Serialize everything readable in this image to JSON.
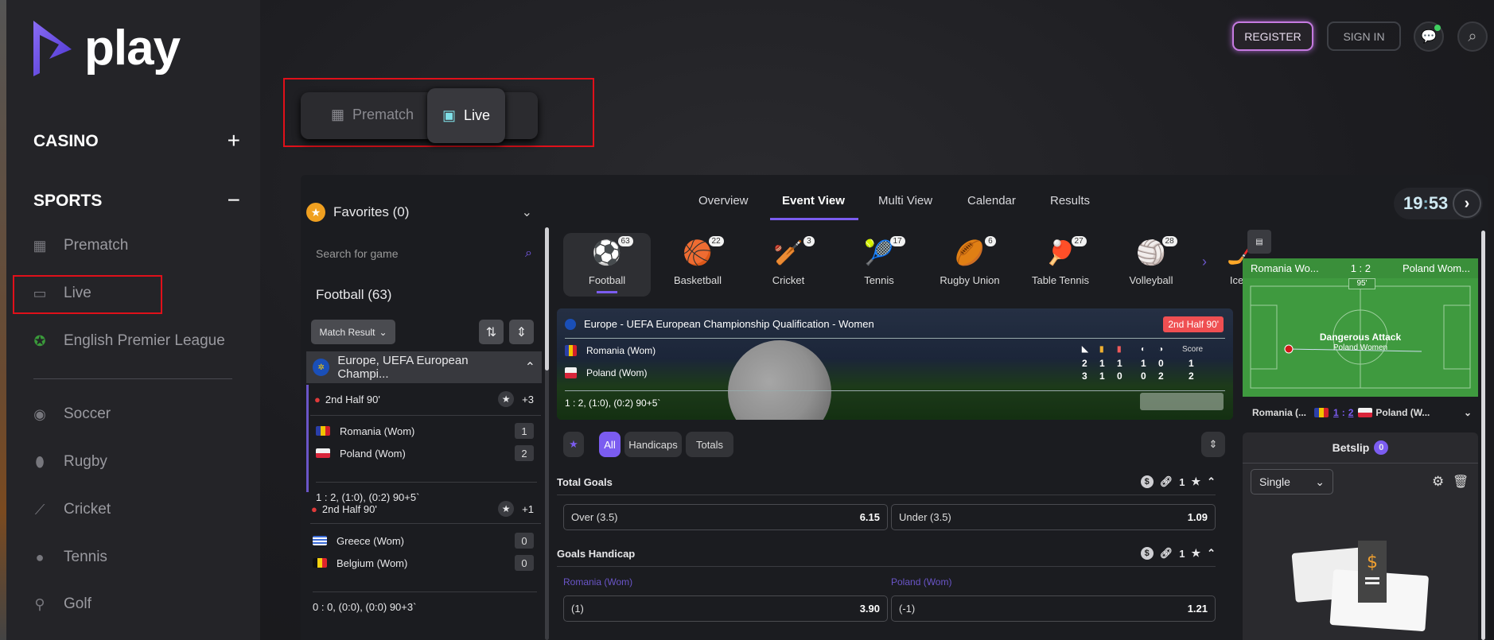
{
  "brand": {
    "name": "play",
    "accent": "#7b5cf0"
  },
  "sidebar": {
    "casino": {
      "label": "CASINO",
      "toggle": "+"
    },
    "sports": {
      "label": "SPORTS",
      "toggle": "−"
    },
    "items": [
      {
        "label": "Prematch",
        "icon": "calendar-icon"
      },
      {
        "label": "Live",
        "icon": "live-tv-icon"
      },
      {
        "label": "English Premier League",
        "icon": "premier-league-icon"
      },
      {
        "label": "Soccer",
        "icon": "soccer-icon"
      },
      {
        "label": "Rugby",
        "icon": "rugby-icon"
      },
      {
        "label": "Cricket",
        "icon": "cricket-icon"
      },
      {
        "label": "Tennis",
        "icon": "tennis-icon"
      },
      {
        "label": "Golf",
        "icon": "golf-icon"
      }
    ]
  },
  "header": {
    "register": "REGISTER",
    "sign_in": "SIGN IN"
  },
  "mode_switch": {
    "prematch": "Prematch",
    "live": "Live",
    "active": "Live"
  },
  "nav": {
    "tabs": [
      "Overview",
      "Event View",
      "Multi View",
      "Calendar",
      "Results"
    ],
    "active": "Event View"
  },
  "clock": {
    "time_h": "19",
    "time_m": "53"
  },
  "left": {
    "favorites": "Favorites (0)",
    "search_placeholder": "Search for game",
    "sport_title": "Football (63)",
    "market_select": "Match Result",
    "league": "Europe, UEFA European Champi...",
    "matches": [
      {
        "status": "2nd Half 90'",
        "more": "+3",
        "home": "Romania (Wom)",
        "away": "Poland (Wom)",
        "home_score": "1",
        "away_score": "2",
        "summary": "1 : 2, (1:0), (0:2) 90+5`"
      },
      {
        "status": "2nd Half 90'",
        "more": "+1",
        "home": "Greece (Wom)",
        "away": "Belgium (Wom)",
        "home_score": "0",
        "away_score": "0",
        "summary": "0 : 0, (0:0), (0:0) 90+3`"
      }
    ]
  },
  "sports": [
    {
      "label": "Football",
      "count": "63",
      "icon": "⚽"
    },
    {
      "label": "Basketball",
      "count": "22",
      "icon": "🏀"
    },
    {
      "label": "Cricket",
      "count": "3",
      "icon": "🏏"
    },
    {
      "label": "Tennis",
      "count": "17",
      "icon": "🎾"
    },
    {
      "label": "Rugby Union",
      "count": "6",
      "icon": "🏉"
    },
    {
      "label": "Table Tennis",
      "count": "27",
      "icon": "🏓"
    },
    {
      "label": "Volleyball",
      "count": "28",
      "icon": "🏐"
    },
    {
      "label": "Ice H",
      "count": "",
      "icon": "🏒"
    }
  ],
  "event": {
    "competition": "Europe - UEFA European Championship Qualification - Women",
    "status": "2nd Half 90'",
    "home": "Romania (Wom)",
    "away": "Poland (Wom)",
    "stats_header": {
      "score": "Score"
    },
    "home_stats": [
      "2",
      "1",
      "1",
      "1",
      "0",
      "1"
    ],
    "away_stats": [
      "3",
      "1",
      "0",
      "0",
      "2",
      "2"
    ],
    "summary": "1 : 2, (1:0), (0:2) 90+5`"
  },
  "filters": {
    "all": "All",
    "handicaps": "Handicaps",
    "totals": "Totals",
    "active": "All"
  },
  "markets": [
    {
      "title": "Total Goals",
      "links": "1",
      "outcomes": [
        {
          "label": "Over (3.5)",
          "odd": "6.15"
        },
        {
          "label": "Under (3.5)",
          "odd": "1.09"
        }
      ]
    },
    {
      "title": "Goals Handicap",
      "links": "1",
      "home": "Romania (Wom)",
      "away": "Poland (Wom)",
      "outcomes": [
        {
          "label": "(1)",
          "odd": "3.90"
        },
        {
          "label": "(-1)",
          "odd": "1.21"
        }
      ]
    }
  ],
  "tracker": {
    "home": "Romania Wo...",
    "away": "Poland Wom...",
    "score": "1 : 2",
    "minute": "95'",
    "event": "Dangerous Attack",
    "team": "Poland Women",
    "home_short": "Romania (...",
    "away_short": "Poland (W...",
    "home_score": "1",
    "away_score": "2"
  },
  "betslip": {
    "title": "Betslip",
    "count": "0",
    "type": "Single"
  }
}
